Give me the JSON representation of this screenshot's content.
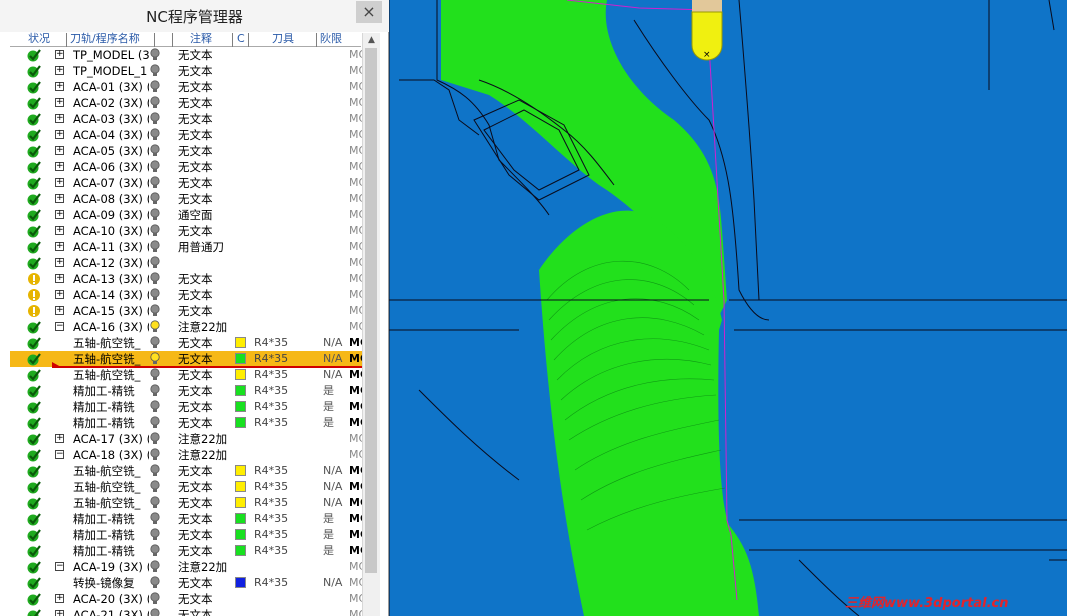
{
  "window": {
    "title": "NC程序管理器",
    "close": "×"
  },
  "columns": [
    "状况",
    "刀轨/程序名称",
    "注释",
    "C",
    "刀具",
    "阦限"
  ],
  "colors": {
    "ok": "#1faa1f",
    "warn": "#e6b400",
    "selected": "#f6b817",
    "toolpath": "#22e01c",
    "part": "#0f74c8"
  },
  "rows": [
    {
      "status": "ok",
      "expand": "plus",
      "name": "TP_MODEL (3X",
      "bulb": "gray",
      "note": "无文本",
      "swatch": "",
      "tool": "",
      "limit": "",
      "mc": "MC",
      "mc_dark": false
    },
    {
      "status": "ok",
      "expand": "plus",
      "name": "TP_MODEL_1 (",
      "bulb": "gray",
      "note": "无文本",
      "swatch": "",
      "tool": "",
      "limit": "",
      "mc": "MC",
      "mc_dark": false
    },
    {
      "status": "ok",
      "expand": "plus",
      "name": "ACA-01 (3X) (1",
      "bulb": "gray",
      "note": "无文本",
      "swatch": "",
      "tool": "",
      "limit": "",
      "mc": "MC",
      "mc_dark": false
    },
    {
      "status": "ok",
      "expand": "plus",
      "name": "ACA-02 (3X) (1",
      "bulb": "gray",
      "note": "无文本",
      "swatch": "",
      "tool": "",
      "limit": "",
      "mc": "MC",
      "mc_dark": false
    },
    {
      "status": "ok",
      "expand": "plus",
      "name": "ACA-03 (3X) (2",
      "bulb": "gray",
      "note": "无文本",
      "swatch": "",
      "tool": "",
      "limit": "",
      "mc": "MC",
      "mc_dark": false
    },
    {
      "status": "ok",
      "expand": "plus",
      "name": "ACA-04 (3X) (5",
      "bulb": "gray",
      "note": "无文本",
      "swatch": "",
      "tool": "",
      "limit": "",
      "mc": "MC",
      "mc_dark": false
    },
    {
      "status": "ok",
      "expand": "plus",
      "name": "ACA-05 (3X) (2",
      "bulb": "gray",
      "note": "无文本",
      "swatch": "",
      "tool": "",
      "limit": "",
      "mc": "MC",
      "mc_dark": false
    },
    {
      "status": "ok",
      "expand": "plus",
      "name": "ACA-06 (3X) (1",
      "bulb": "gray",
      "note": "无文本",
      "swatch": "",
      "tool": "",
      "limit": "",
      "mc": "MC",
      "mc_dark": false
    },
    {
      "status": "ok",
      "expand": "plus",
      "name": "ACA-07 (3X) (1",
      "bulb": "gray",
      "note": "无文本",
      "swatch": "",
      "tool": "",
      "limit": "",
      "mc": "MC",
      "mc_dark": false
    },
    {
      "status": "ok",
      "expand": "plus",
      "name": "ACA-08 (3X) (1",
      "bulb": "gray",
      "note": "无文本",
      "swatch": "",
      "tool": "",
      "limit": "",
      "mc": "MC",
      "mc_dark": false
    },
    {
      "status": "ok",
      "expand": "plus",
      "name": "ACA-09 (3X) (2",
      "bulb": "gray",
      "note": "通空面",
      "swatch": "",
      "tool": "",
      "limit": "",
      "mc": "MC",
      "mc_dark": false
    },
    {
      "status": "ok",
      "expand": "plus",
      "name": "ACA-10 (3X) (1",
      "bulb": "gray",
      "note": "无文本",
      "swatch": "",
      "tool": "",
      "limit": "",
      "mc": "MC",
      "mc_dark": false
    },
    {
      "status": "ok",
      "expand": "plus",
      "name": "ACA-11 (3X) (2",
      "bulb": "gray",
      "note": "用普通刀",
      "swatch": "",
      "tool": "",
      "limit": "",
      "mc": "MC",
      "mc_dark": false
    },
    {
      "status": "ok",
      "expand": "plus",
      "name": "ACA-12 (3X) (1",
      "bulb": "gray",
      "note": "",
      "swatch": "",
      "tool": "",
      "limit": "",
      "mc": "MC",
      "mc_dark": false
    },
    {
      "status": "warn",
      "expand": "plus",
      "name": "ACA-13 (3X) (1",
      "bulb": "gray",
      "note": "无文本",
      "swatch": "",
      "tool": "",
      "limit": "",
      "mc": "MC",
      "mc_dark": false
    },
    {
      "status": "warn",
      "expand": "plus",
      "name": "ACA-14 (3X) (2",
      "bulb": "gray",
      "note": "无文本",
      "swatch": "",
      "tool": "",
      "limit": "",
      "mc": "MC",
      "mc_dark": false
    },
    {
      "status": "warn",
      "expand": "plus",
      "name": "ACA-15 (3X) (1",
      "bulb": "gray",
      "note": "无文本",
      "swatch": "",
      "tool": "",
      "limit": "",
      "mc": "MC",
      "mc_dark": false
    },
    {
      "status": "ok",
      "expand": "minus",
      "name": "ACA-16 (3X) (6",
      "bulb": "yellow",
      "note": "注意22加",
      "swatch": "",
      "tool": "",
      "limit": "",
      "mc": "MC",
      "mc_dark": false
    },
    {
      "status": "ok",
      "expand": "",
      "name": "五轴-航空铣_",
      "bulb": "gray",
      "note": "无文本",
      "swatch": "#ffee00",
      "tool": "R4*35",
      "limit": "N/A",
      "mc": "MC",
      "mc_dark": true
    },
    {
      "status": "ok",
      "expand": "",
      "name": "五轴-航空铣_",
      "bulb": "yellow",
      "note": "无文本",
      "swatch": "#18e020",
      "tool": "R4*35",
      "limit": "N/A",
      "mc": "MC",
      "mc_dark": true,
      "selected": true
    },
    {
      "status": "ok",
      "expand": "",
      "name": "五轴-航空铣_",
      "bulb": "gray",
      "note": "无文本",
      "swatch": "#ffee00",
      "tool": "R4*35",
      "limit": "N/A",
      "mc": "MC",
      "mc_dark": true
    },
    {
      "status": "ok",
      "expand": "",
      "name": "精加工-精铣",
      "bulb": "gray",
      "note": "无文本",
      "swatch": "#18e020",
      "tool": "R4*35",
      "limit": "是",
      "mc": "MC",
      "mc_dark": true
    },
    {
      "status": "ok",
      "expand": "",
      "name": "精加工-精铣",
      "bulb": "gray",
      "note": "无文本",
      "swatch": "#18e020",
      "tool": "R4*35",
      "limit": "是",
      "mc": "MC",
      "mc_dark": true
    },
    {
      "status": "ok",
      "expand": "",
      "name": "精加工-精铣",
      "bulb": "gray",
      "note": "无文本",
      "swatch": "#18e020",
      "tool": "R4*35",
      "limit": "是",
      "mc": "MC",
      "mc_dark": true
    },
    {
      "status": "ok",
      "expand": "plus",
      "name": "ACA-17 (3X) (1",
      "bulb": "gray",
      "note": "注意22加",
      "swatch": "",
      "tool": "",
      "limit": "",
      "mc": "MC",
      "mc_dark": false
    },
    {
      "status": "ok",
      "expand": "minus",
      "name": "ACA-18 (3X) (6",
      "bulb": "gray",
      "note": "注意22加",
      "swatch": "",
      "tool": "",
      "limit": "",
      "mc": "MC",
      "mc_dark": false
    },
    {
      "status": "ok",
      "expand": "",
      "name": "五轴-航空铣_",
      "bulb": "gray",
      "note": "无文本",
      "swatch": "#ffee00",
      "tool": "R4*35",
      "limit": "N/A",
      "mc": "MC",
      "mc_dark": true
    },
    {
      "status": "ok",
      "expand": "",
      "name": "五轴-航空铣_",
      "bulb": "gray",
      "note": "无文本",
      "swatch": "#ffee00",
      "tool": "R4*35",
      "limit": "N/A",
      "mc": "MC",
      "mc_dark": true
    },
    {
      "status": "ok",
      "expand": "",
      "name": "五轴-航空铣_",
      "bulb": "gray",
      "note": "无文本",
      "swatch": "#ffee00",
      "tool": "R4*35",
      "limit": "N/A",
      "mc": "MC",
      "mc_dark": true
    },
    {
      "status": "ok",
      "expand": "",
      "name": "精加工-精铣",
      "bulb": "gray",
      "note": "无文本",
      "swatch": "#18e020",
      "tool": "R4*35",
      "limit": "是",
      "mc": "MC",
      "mc_dark": true
    },
    {
      "status": "ok",
      "expand": "",
      "name": "精加工-精铣",
      "bulb": "gray",
      "note": "无文本",
      "swatch": "#18e020",
      "tool": "R4*35",
      "limit": "是",
      "mc": "MC",
      "mc_dark": true
    },
    {
      "status": "ok",
      "expand": "",
      "name": "精加工-精铣",
      "bulb": "gray",
      "note": "无文本",
      "swatch": "#18e020",
      "tool": "R4*35",
      "limit": "是",
      "mc": "MC",
      "mc_dark": true
    },
    {
      "status": "ok",
      "expand": "minus",
      "name": "ACA-19 (3X) (1",
      "bulb": "gray",
      "note": "注意22加",
      "swatch": "",
      "tool": "",
      "limit": "",
      "mc": "MC",
      "mc_dark": false
    },
    {
      "status": "ok",
      "expand": "",
      "name": "转换-镜像复",
      "bulb": "gray",
      "note": "无文本",
      "swatch": "#1020e0",
      "tool": "R4*35",
      "limit": "N/A",
      "mc": "MC",
      "mc_dark": false
    },
    {
      "status": "ok",
      "expand": "plus",
      "name": "ACA-20 (3X) (2",
      "bulb": "gray",
      "note": "无文本",
      "swatch": "",
      "tool": "",
      "limit": "",
      "mc": "MC",
      "mc_dark": false
    },
    {
      "status": "ok",
      "expand": "plus",
      "name": "ACA-21 (3X) (2",
      "bulb": "gray",
      "note": "无文本",
      "swatch": "",
      "tool": "",
      "limit": "",
      "mc": "MC",
      "mc_dark": false
    }
  ],
  "watermark": "三维网www.3dportal.cn"
}
